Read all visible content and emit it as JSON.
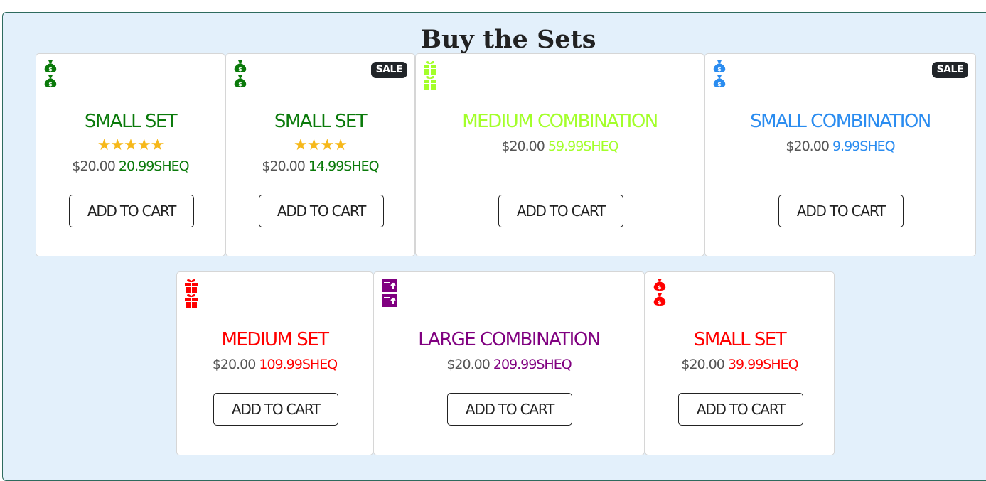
{
  "section": {
    "title": "Buy the Sets"
  },
  "sale_label": "SALE",
  "cart_label": "ADD TO CART",
  "colors": {
    "green": "#0a7a0a",
    "lime": "#a3ff2a",
    "blue": "#2a8cf0",
    "red": "#ff0000",
    "purple": "#800080",
    "star": "#f6b81a",
    "panel_bg": "#e3f0fb"
  },
  "products": [
    {
      "name": "SMALL SET",
      "icon": "money-bag-icon",
      "sale": false,
      "rating": 5,
      "stars": "★★★★★",
      "old_price": "$20.00",
      "price": "20.99SHEQ",
      "color": "#0a7a0a"
    },
    {
      "name": "SMALL SET",
      "icon": "money-bag-icon",
      "sale": true,
      "rating": 4,
      "stars": "★★★★",
      "old_price": "$20.00",
      "price": "14.99SHEQ",
      "color": "#0a7a0a"
    },
    {
      "name": "MEDIUM COMBINATION",
      "icon": "gift-icon",
      "sale": false,
      "old_price": "$20.00",
      "price": "59.99SHEQ",
      "color": "#a3ff2a"
    },
    {
      "name": "SMALL COMBINATION",
      "icon": "money-bag-icon",
      "sale": true,
      "old_price": "$20.00",
      "price": "9.99SHEQ",
      "color": "#2a8cf0"
    },
    {
      "name": "MEDIUM SET",
      "icon": "gift-icon",
      "sale": false,
      "old_price": "$20.00",
      "price": "109.99SHEQ",
      "color": "#ff0000"
    },
    {
      "name": "LARGE COMBINATION",
      "icon": "box-upload-icon",
      "sale": false,
      "old_price": "$20.00",
      "price": "209.99SHEQ",
      "color": "#800080"
    },
    {
      "name": "SMALL SET",
      "icon": "money-bag-icon",
      "sale": false,
      "old_price": "$20.00",
      "price": "39.99SHEQ",
      "color": "#ff0000"
    }
  ]
}
